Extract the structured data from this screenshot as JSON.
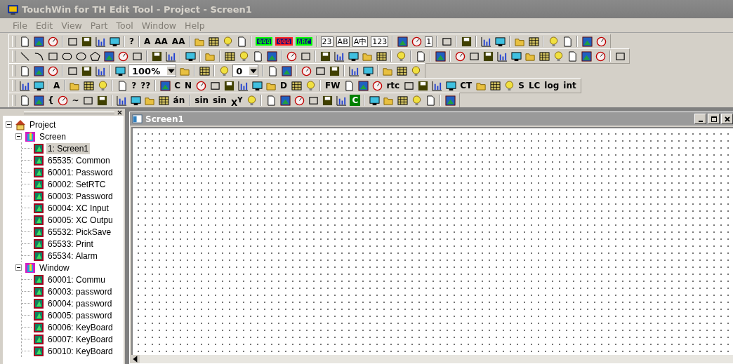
{
  "window": {
    "title": "TouchWin for TH Edit Tool - Project - Screen1"
  },
  "menu": [
    "File",
    "Edit",
    "View",
    "Part",
    "Tool",
    "Window",
    "Help"
  ],
  "toolbars": [
    {
      "items": [
        {
          "kind": "icon"
        },
        {
          "kind": "icon"
        },
        {
          "kind": "icon"
        },
        {
          "kind": "sep"
        },
        {
          "kind": "icon"
        },
        {
          "kind": "icon"
        },
        {
          "kind": "icon"
        },
        {
          "kind": "icon"
        },
        {
          "kind": "sep"
        },
        {
          "kind": "text",
          "label": "?"
        },
        {
          "kind": "sep"
        },
        {
          "kind": "text",
          "label": "A"
        },
        {
          "kind": "text",
          "label": "AA"
        },
        {
          "kind": "text",
          "label": "AA"
        },
        {
          "kind": "sep"
        },
        {
          "kind": "icon"
        },
        {
          "kind": "icon"
        },
        {
          "kind": "icon"
        },
        {
          "kind": "icon"
        },
        {
          "kind": "sep"
        },
        {
          "kind": "lcd",
          "label": "999",
          "color": "#00ff00"
        },
        {
          "kind": "lcd",
          "label": "999",
          "color": "#ff2020"
        },
        {
          "kind": "lcd",
          "label": "ABC",
          "color": "#00ff00"
        },
        {
          "kind": "sep"
        },
        {
          "kind": "boxed",
          "label": "23"
        },
        {
          "kind": "boxed",
          "label": "AB"
        },
        {
          "kind": "boxed",
          "label": "A中"
        },
        {
          "kind": "boxed",
          "label": "123"
        },
        {
          "kind": "sep"
        },
        {
          "kind": "icon"
        },
        {
          "kind": "icon"
        },
        {
          "kind": "boxed",
          "label": "1"
        },
        {
          "kind": "sep"
        },
        {
          "kind": "icon"
        },
        {
          "kind": "sep"
        },
        {
          "kind": "icon"
        },
        {
          "kind": "sep"
        },
        {
          "kind": "icon"
        },
        {
          "kind": "icon"
        },
        {
          "kind": "sep"
        },
        {
          "kind": "icon"
        },
        {
          "kind": "icon"
        },
        {
          "kind": "sep"
        },
        {
          "kind": "icon"
        },
        {
          "kind": "icon"
        },
        {
          "kind": "sep"
        },
        {
          "kind": "icon"
        },
        {
          "kind": "icon"
        }
      ]
    },
    {
      "items": [
        {
          "kind": "icon"
        },
        {
          "kind": "icon"
        },
        {
          "kind": "icon"
        },
        {
          "kind": "icon"
        },
        {
          "kind": "icon"
        },
        {
          "kind": "icon"
        },
        {
          "kind": "icon"
        },
        {
          "kind": "icon"
        },
        {
          "kind": "icon"
        },
        {
          "kind": "sep"
        },
        {
          "kind": "icon"
        },
        {
          "kind": "icon"
        },
        {
          "kind": "sep"
        },
        {
          "kind": "icon"
        },
        {
          "kind": "sep"
        },
        {
          "kind": "icon"
        },
        {
          "kind": "sep"
        },
        {
          "kind": "icon"
        },
        {
          "kind": "icon"
        },
        {
          "kind": "icon"
        },
        {
          "kind": "icon"
        },
        {
          "kind": "sep"
        },
        {
          "kind": "icon"
        },
        {
          "kind": "icon"
        },
        {
          "kind": "sep"
        },
        {
          "kind": "icon"
        },
        {
          "kind": "icon"
        },
        {
          "kind": "icon"
        },
        {
          "kind": "icon"
        },
        {
          "kind": "icon"
        },
        {
          "kind": "sep"
        },
        {
          "kind": "icon"
        },
        {
          "kind": "sep"
        },
        {
          "kind": "icon"
        },
        {
          "kind": "sep"
        },
        {
          "kind": "icon"
        },
        {
          "kind": "sep"
        },
        {
          "kind": "icon"
        },
        {
          "kind": "icon"
        },
        {
          "kind": "icon"
        },
        {
          "kind": "icon"
        },
        {
          "kind": "icon"
        },
        {
          "kind": "icon"
        },
        {
          "kind": "icon"
        },
        {
          "kind": "icon"
        },
        {
          "kind": "icon"
        },
        {
          "kind": "icon"
        },
        {
          "kind": "icon"
        },
        {
          "kind": "sep"
        },
        {
          "kind": "icon"
        }
      ]
    },
    {
      "items": [
        {
          "kind": "icon"
        },
        {
          "kind": "icon"
        },
        {
          "kind": "icon"
        },
        {
          "kind": "sep"
        },
        {
          "kind": "icon"
        },
        {
          "kind": "icon"
        },
        {
          "kind": "icon"
        },
        {
          "kind": "sep"
        },
        {
          "kind": "icon"
        },
        {
          "kind": "combo",
          "value": "100%"
        },
        {
          "kind": "icon"
        },
        {
          "kind": "sep"
        },
        {
          "kind": "icon"
        },
        {
          "kind": "sep"
        },
        {
          "kind": "icon"
        },
        {
          "kind": "combo",
          "value": "0"
        },
        {
          "kind": "sep"
        },
        {
          "kind": "icon"
        },
        {
          "kind": "icon"
        },
        {
          "kind": "sep"
        },
        {
          "kind": "icon"
        },
        {
          "kind": "icon"
        },
        {
          "kind": "icon"
        },
        {
          "kind": "sep"
        },
        {
          "kind": "icon"
        },
        {
          "kind": "icon"
        },
        {
          "kind": "sep"
        },
        {
          "kind": "icon"
        },
        {
          "kind": "icon"
        },
        {
          "kind": "icon"
        }
      ]
    },
    {
      "items": [
        {
          "kind": "icon"
        },
        {
          "kind": "icon"
        },
        {
          "kind": "sep"
        },
        {
          "kind": "text",
          "label": "A"
        },
        {
          "kind": "sep"
        },
        {
          "kind": "icon"
        },
        {
          "kind": "icon"
        },
        {
          "kind": "icon"
        },
        {
          "kind": "sep"
        },
        {
          "kind": "icon"
        },
        {
          "kind": "text",
          "label": "?"
        },
        {
          "kind": "text",
          "label": "??"
        },
        {
          "kind": "sep"
        },
        {
          "kind": "icon"
        },
        {
          "kind": "text",
          "label": "C"
        },
        {
          "kind": "text",
          "label": "N"
        },
        {
          "kind": "icon"
        },
        {
          "kind": "icon"
        },
        {
          "kind": "icon"
        },
        {
          "kind": "icon"
        },
        {
          "kind": "icon"
        },
        {
          "kind": "icon"
        },
        {
          "kind": "text",
          "label": "D"
        },
        {
          "kind": "icon"
        },
        {
          "kind": "icon"
        },
        {
          "kind": "sep"
        },
        {
          "kind": "text",
          "label": "FW"
        },
        {
          "kind": "icon"
        },
        {
          "kind": "icon"
        },
        {
          "kind": "icon"
        },
        {
          "kind": "text",
          "label": "rtc"
        },
        {
          "kind": "icon"
        },
        {
          "kind": "icon"
        },
        {
          "kind": "icon"
        },
        {
          "kind": "icon"
        },
        {
          "kind": "text",
          "label": "CT"
        },
        {
          "kind": "icon"
        },
        {
          "kind": "icon"
        },
        {
          "kind": "icon"
        },
        {
          "kind": "text",
          "label": "S"
        },
        {
          "kind": "text",
          "label": "LC"
        },
        {
          "kind": "text",
          "label": "log"
        },
        {
          "kind": "text",
          "label": "int"
        }
      ]
    },
    {
      "items": [
        {
          "kind": "icon"
        },
        {
          "kind": "icon"
        },
        {
          "kind": "text",
          "label": "{"
        },
        {
          "kind": "icon"
        },
        {
          "kind": "text",
          "label": "~"
        },
        {
          "kind": "icon"
        },
        {
          "kind": "icon"
        },
        {
          "kind": "sep"
        },
        {
          "kind": "icon"
        },
        {
          "kind": "icon"
        },
        {
          "kind": "icon"
        },
        {
          "kind": "icon"
        },
        {
          "kind": "text",
          "label": "án"
        },
        {
          "kind": "sep"
        },
        {
          "kind": "text",
          "label": "sin"
        },
        {
          "kind": "text",
          "label": "sin"
        },
        {
          "kind": "text",
          "label": "X$^{Y}$"
        },
        {
          "kind": "icon"
        },
        {
          "kind": "sep"
        },
        {
          "kind": "icon"
        },
        {
          "kind": "icon"
        },
        {
          "kind": "icon"
        },
        {
          "kind": "icon"
        },
        {
          "kind": "icon"
        },
        {
          "kind": "icon"
        },
        {
          "kind": "tag",
          "label": "C",
          "color": "#008000"
        },
        {
          "kind": "sep"
        },
        {
          "kind": "icon"
        },
        {
          "kind": "icon"
        },
        {
          "kind": "icon"
        },
        {
          "kind": "icon"
        },
        {
          "kind": "icon"
        },
        {
          "kind": "sep"
        },
        {
          "kind": "icon"
        }
      ]
    }
  ],
  "project_tree": {
    "label": "Project",
    "expanded": true,
    "children": [
      {
        "label": "Screen",
        "expanded": true,
        "children": [
          {
            "label": "1: Screen1",
            "selected": true
          },
          {
            "label": "65535: Common",
            "selected": false
          },
          {
            "label": "60001: Password",
            "selected": false
          },
          {
            "label": "60002: SetRTC",
            "selected": false
          },
          {
            "label": "60003: Password",
            "selected": false
          },
          {
            "label": "60004: XC Input",
            "selected": false
          },
          {
            "label": "60005: XC Outpu",
            "selected": false
          },
          {
            "label": "65532: PickSave",
            "selected": false
          },
          {
            "label": "65533: Print",
            "selected": false
          },
          {
            "label": "65534: Alarm",
            "selected": false
          }
        ]
      },
      {
        "label": "Window",
        "expanded": true,
        "children": [
          {
            "label": "60001: Commu",
            "selected": false
          },
          {
            "label": "60003: password",
            "selected": false
          },
          {
            "label": "60004: password",
            "selected": false
          },
          {
            "label": "60005: password",
            "selected": false
          },
          {
            "label": "60006: KeyBoard",
            "selected": false
          },
          {
            "label": "60007: KeyBoard",
            "selected": false
          },
          {
            "label": "60010: KeyBoard",
            "selected": false
          }
        ]
      }
    ]
  },
  "document": {
    "title": "Screen1"
  }
}
